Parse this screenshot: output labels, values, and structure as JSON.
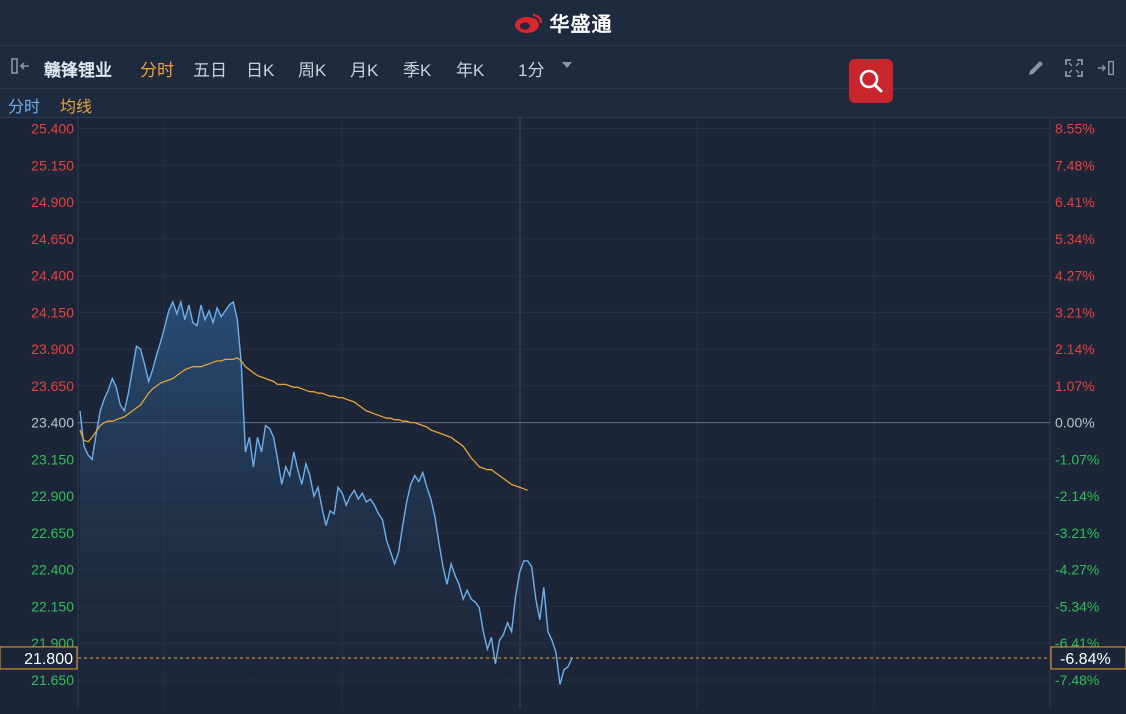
{
  "app": {
    "name": "华盛通"
  },
  "toolbar": {
    "stock_name": "赣锋锂业",
    "tabs": [
      "分时",
      "五日",
      "日K",
      "周K",
      "月K",
      "季K",
      "年K"
    ],
    "active_tab": "分时",
    "interval": "1分"
  },
  "legend": {
    "minute_label": "分时",
    "avg_label": "均线"
  },
  "colors": {
    "up": "#e8403c",
    "down": "#2fbf5a",
    "price_line": "#6fb0ec",
    "avg_line": "#e8a33a",
    "accent": "#f0a030",
    "search_button": "#c8252c"
  },
  "chart_data": {
    "type": "line",
    "prev_close": 23.4,
    "current_price": "21.800",
    "current_change": "-6.84%",
    "y_left_ticks": [
      "25.400",
      "25.150",
      "24.900",
      "24.650",
      "24.400",
      "24.150",
      "23.900",
      "23.650",
      "23.400",
      "23.150",
      "22.900",
      "22.650",
      "22.400",
      "22.150",
      "21.900",
      "21.650"
    ],
    "y_right_ticks": [
      "8.55%",
      "7.48%",
      "6.41%",
      "5.34%",
      "4.27%",
      "3.21%",
      "2.14%",
      "1.07%",
      "0.00%",
      "-1.07%",
      "-2.14%",
      "-3.21%",
      "-4.27%",
      "-5.34%",
      "-6.41%",
      "-7.48%"
    ],
    "ylim": [
      21.55,
      25.45
    ],
    "total_minutes": 240,
    "series": [
      {
        "name": "分时",
        "values": [
          23.48,
          23.24,
          23.18,
          23.15,
          23.32,
          23.48,
          23.56,
          23.62,
          23.7,
          23.64,
          23.52,
          23.48,
          23.6,
          23.76,
          23.92,
          23.9,
          23.8,
          23.68,
          23.76,
          23.86,
          23.95,
          24.05,
          24.16,
          24.22,
          24.14,
          24.22,
          24.1,
          24.2,
          24.08,
          24.06,
          24.2,
          24.1,
          24.16,
          24.08,
          24.18,
          24.12,
          24.16,
          24.2,
          24.22,
          24.1,
          23.8,
          23.2,
          23.3,
          23.1,
          23.3,
          23.2,
          23.38,
          23.36,
          23.3,
          23.15,
          22.98,
          23.1,
          23.04,
          23.2,
          23.08,
          22.98,
          23.12,
          23.04,
          22.9,
          22.96,
          22.82,
          22.7,
          22.8,
          22.78,
          22.96,
          22.92,
          22.84,
          22.9,
          22.94,
          22.88,
          22.92,
          22.86,
          22.88,
          22.84,
          22.78,
          22.74,
          22.6,
          22.52,
          22.44,
          22.52,
          22.7,
          22.86,
          22.98,
          23.04,
          23.0,
          23.06,
          22.96,
          22.88,
          22.76,
          22.58,
          22.42,
          22.3,
          22.44,
          22.36,
          22.3,
          22.2,
          22.26,
          22.2,
          22.18,
          22.14,
          21.98,
          21.86,
          21.94,
          21.76,
          21.92,
          21.96,
          22.04,
          21.98,
          22.22,
          22.38,
          22.46,
          22.46,
          22.42,
          22.2,
          22.06,
          22.28,
          21.98,
          21.92,
          21.84,
          21.62,
          21.72,
          21.74,
          21.8
        ],
        "color": "#6fb0ec"
      },
      {
        "name": "均线",
        "values": [
          23.35,
          23.28,
          23.27,
          23.3,
          23.34,
          23.38,
          23.4,
          23.41,
          23.41,
          23.42,
          23.43,
          23.44,
          23.46,
          23.48,
          23.5,
          23.52,
          23.56,
          23.6,
          23.63,
          23.65,
          23.67,
          23.68,
          23.69,
          23.7,
          23.72,
          23.74,
          23.76,
          23.77,
          23.78,
          23.78,
          23.78,
          23.79,
          23.8,
          23.81,
          23.82,
          23.82,
          23.83,
          23.83,
          23.83,
          23.84,
          23.82,
          23.78,
          23.76,
          23.74,
          23.72,
          23.71,
          23.7,
          23.69,
          23.68,
          23.66,
          23.66,
          23.66,
          23.65,
          23.64,
          23.64,
          23.63,
          23.62,
          23.61,
          23.61,
          23.6,
          23.6,
          23.59,
          23.58,
          23.58,
          23.57,
          23.57,
          23.56,
          23.55,
          23.54,
          23.52,
          23.5,
          23.48,
          23.47,
          23.46,
          23.45,
          23.44,
          23.43,
          23.43,
          23.42,
          23.42,
          23.41,
          23.41,
          23.4,
          23.4,
          23.39,
          23.38,
          23.37,
          23.35,
          23.34,
          23.33,
          23.32,
          23.31,
          23.3,
          23.28,
          23.26,
          23.24,
          23.2,
          23.16,
          23.13,
          23.1,
          23.09,
          23.08,
          23.08,
          23.06,
          23.04,
          23.02,
          23.0,
          22.98,
          22.97,
          22.96,
          22.95,
          22.94
        ]
      }
    ]
  }
}
